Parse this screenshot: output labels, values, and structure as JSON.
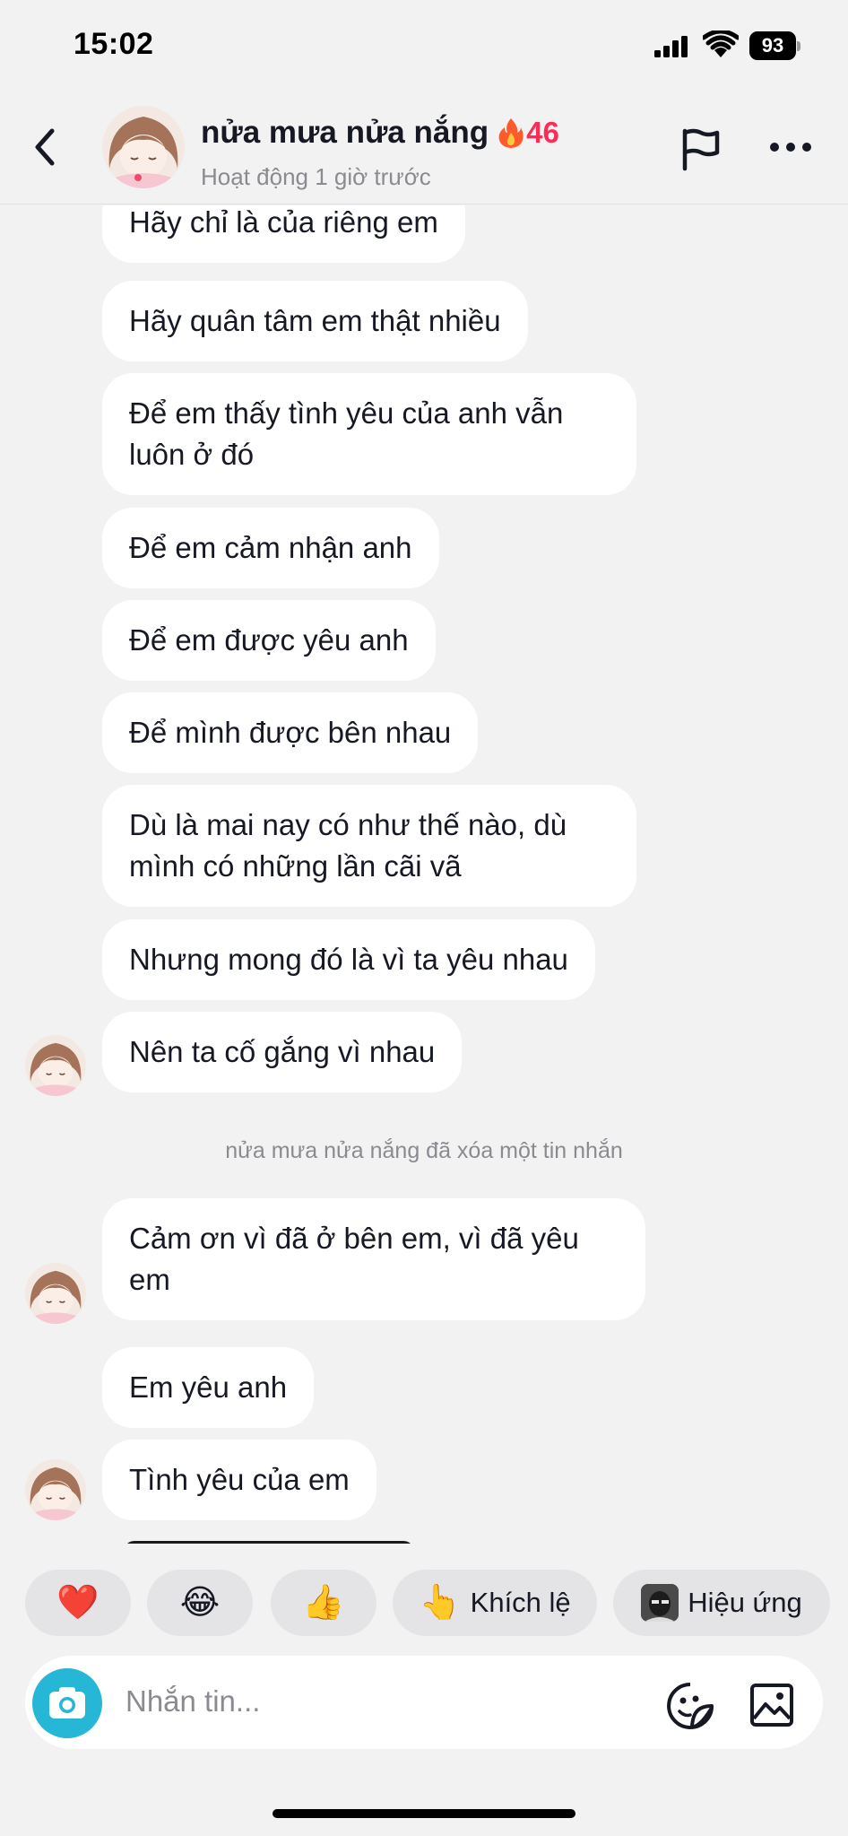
{
  "status_bar": {
    "time": "15:02",
    "battery": "93"
  },
  "header": {
    "name": "nửa mưa nửa nắng",
    "streak": "46",
    "status": "Hoạt động 1 giờ trước"
  },
  "messages": [
    {
      "text": "Hãy chỉ là của riêng em"
    },
    {
      "text": "Hãy quân tâm em thật nhiều"
    },
    {
      "text": "Để em thấy tình yêu của anh vẫn luôn ở đó"
    },
    {
      "text": "Để em cảm nhận anh"
    },
    {
      "text": "Để em được yêu anh"
    },
    {
      "text": "Để mình được bên nhau"
    },
    {
      "text": "Dù là mai nay có như thế nào, dù mình có những lần cãi vã"
    },
    {
      "text": "Nhưng mong đó là vì ta yêu nhau"
    },
    {
      "text": "Nên ta cố gắng vì nhau"
    },
    {
      "text": "Cảm ơn vì đã ở bên em, vì đã yêu em"
    },
    {
      "text": "Em yêu anh"
    },
    {
      "text": "Tình yêu của em"
    }
  ],
  "system_note": "nửa mưa nửa nắng đã xóa một tin nhắn",
  "reactions": [
    {
      "emoji": "❤️",
      "icon": "heart-icon"
    },
    {
      "emoji": "😂",
      "icon": "laughing-face-icon"
    },
    {
      "emoji": "👍",
      "icon": "thumbs-up-icon"
    },
    {
      "emoji": "👆",
      "label": "Khích lệ",
      "icon": "pointing-hand-icon"
    },
    {
      "label": "Hiệu ứng",
      "icon": "effect-thumbnail-icon"
    }
  ],
  "input": {
    "placeholder": "Nhắn tin..."
  },
  "colors": {
    "accent": "#fe2c55",
    "camera": "#26b7d6",
    "background": "#f2f2f2",
    "bubble": "#ffffff"
  }
}
